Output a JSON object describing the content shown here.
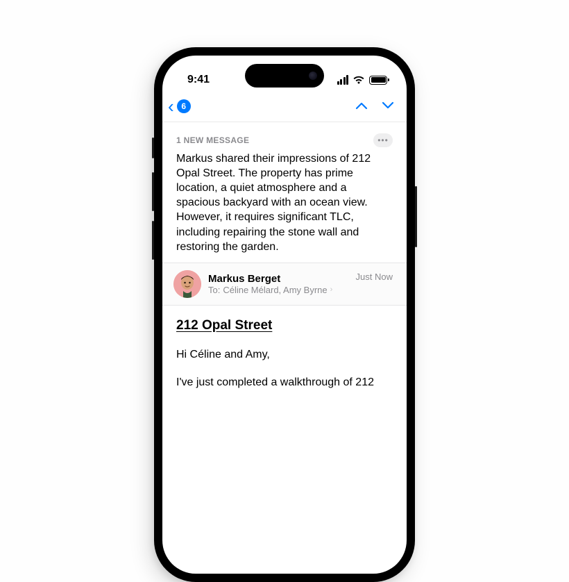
{
  "status": {
    "time": "9:41"
  },
  "nav": {
    "unread_count": "6"
  },
  "summary": {
    "label": "1 NEW MESSAGE",
    "text": "Markus shared their impressions of 212 Opal Street. The property has prime location, a quiet atmosphere and a spacious backyard with an ocean view. However, it requires significant TLC, including repairing the stone wall and restoring the garden."
  },
  "message": {
    "sender_name": "Markus Berget",
    "to_label": "To:",
    "recipients": "Céline Mélard, Amy Byrne",
    "time": "Just Now",
    "subject": "212 Opal Street",
    "greeting": "Hi Céline and Amy,",
    "body_line": "I've just completed a walkthrough of 212"
  }
}
